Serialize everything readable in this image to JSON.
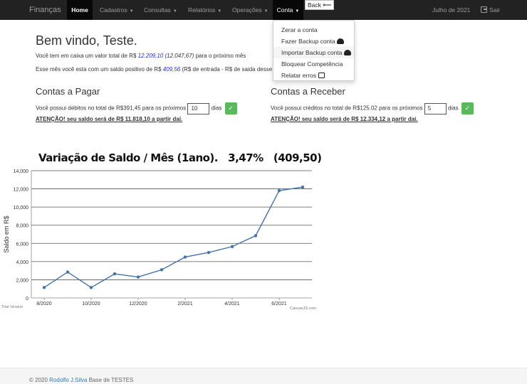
{
  "navbar": {
    "brand": "Finanças",
    "items": [
      {
        "label": "Home"
      },
      {
        "label": "Cadastros"
      },
      {
        "label": "Consultas"
      },
      {
        "label": "Relatórios"
      },
      {
        "label": "Operações"
      },
      {
        "label": "Conta"
      }
    ],
    "period": "Julho de 2021",
    "signout": "Sair",
    "signout_icon": "sign-out-icon"
  },
  "back_tooltip": "Back ⟵",
  "dropdown": {
    "items": [
      {
        "label": "Zerar a conta",
        "icon": ""
      },
      {
        "label": "Fazer Backup conta",
        "icon": "cloud-upload-icon"
      },
      {
        "label": "Importar Backup conta",
        "icon": "cloud-download-icon"
      },
      {
        "label": "Bloquear Competência",
        "icon": ""
      },
      {
        "label": "Relatar erros",
        "icon": "bug-report-icon"
      }
    ]
  },
  "welcome": "Bem vindo, Teste.",
  "balance": {
    "prefix": "Você tem em caixa um valor total de R$ ",
    "value": "12.209,10",
    "paren": "(12.047,67)",
    "suffix": " para o próximo mês"
  },
  "month": {
    "prefix": "Esse mês você esta com um saldo positivo de R$ ",
    "value": "409,56",
    "suffix": " (R$ de entrada - R$ de saida desse"
  },
  "payables": {
    "title": "Contas a Pagar",
    "text": "Você possui débitos no total de R$391,45 para os próximos",
    "days": "10",
    "days_label": "dias",
    "warning": "ATENÇÃO! seu saldo será de R$ 11.818,10 a partir daí."
  },
  "receivables": {
    "title": "Contas a Receber",
    "text": "Você possui créditos no total de R$125.02 para os próximos",
    "days": "5",
    "days_label": "dias",
    "warning": "ATENÇÃO! seu saldo será de R$ 12.334,12 a partir daí."
  },
  "ok_glyph": "✓",
  "colors": {
    "navbar": "#222222",
    "line": "#4572a7",
    "ok_button": "#5cb85c",
    "link": "#337ab7"
  },
  "chart_data": {
    "type": "line",
    "title": "Variação de Saldo / Mês (1ano).   3,47%   (409,50)",
    "ylabel": "Saldo em R$",
    "xlabel": "",
    "ylim": [
      0,
      14000
    ],
    "yticks": [
      "0",
      "2,000",
      "4,000",
      "6,000",
      "8,000",
      "10,000",
      "12,000",
      "14,000"
    ],
    "xticks": [
      "8/2020",
      "10/2020",
      "12/2020",
      "2/2021",
      "4/2021",
      "6/2021"
    ],
    "x": [
      "8/2020",
      "9/2020",
      "10/2020",
      "11/2020",
      "12/2020",
      "1/2021",
      "2/2021",
      "3/2021",
      "4/2021",
      "5/2021",
      "6/2021",
      "7/2021"
    ],
    "values": [
      1150,
      2850,
      1150,
      2650,
      2300,
      3100,
      4500,
      5000,
      5650,
      6850,
      11800,
      12200
    ],
    "grid": true,
    "watermark_left": "Trial Version",
    "watermark_right": "CanvasJS.com"
  },
  "footer": {
    "prefix": "© 2020 ",
    "author": "Rodolfo J.Silva",
    "suffix": " Base de TESTES"
  }
}
